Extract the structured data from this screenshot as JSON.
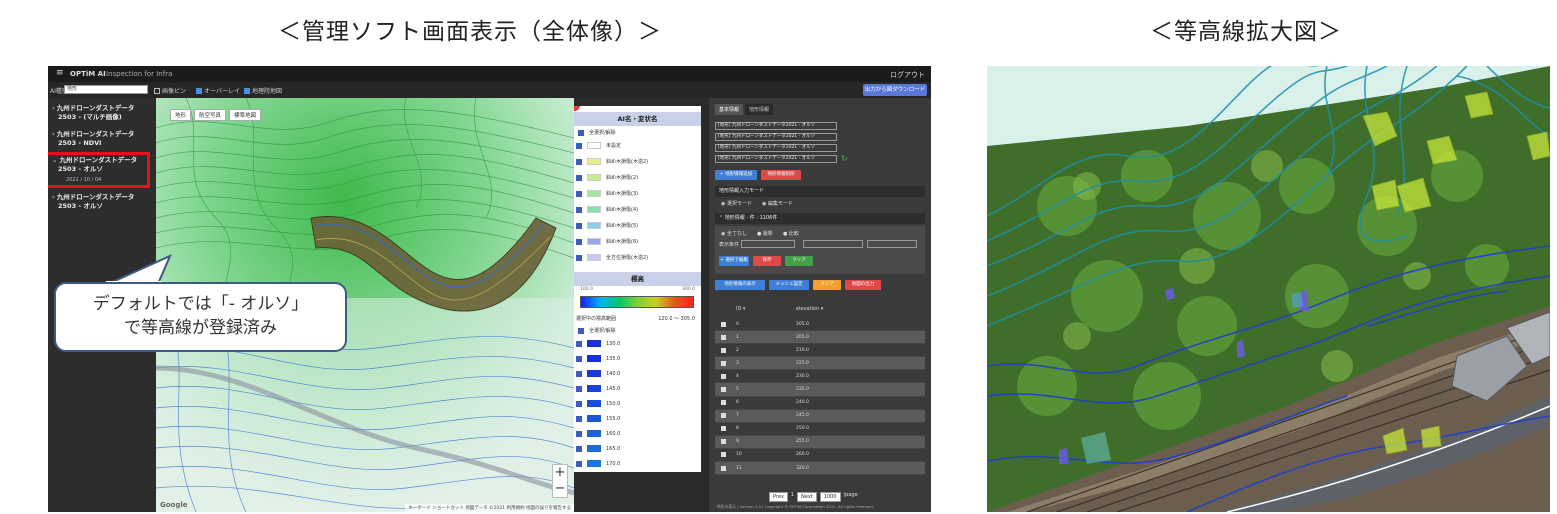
{
  "titles": {
    "left": "＜管理ソフト画面表示（全体像）＞",
    "right": "＜等高線拡大図＞"
  },
  "app": {
    "brand": "OPTiM AI",
    "brand_sub": "Inspection for Infra",
    "logout": "ログアウト",
    "ai_label": "AI種別",
    "ai_value": "地形",
    "toggles": [
      {
        "label": "画像ピン",
        "checked": false
      },
      {
        "label": "オーバーレイ",
        "checked": true
      },
      {
        "label": "地理院地図",
        "checked": true
      }
    ],
    "export_label": "出力から図ダウンロード",
    "sidebar": [
      {
        "line1": "九州ドローンダストデータ",
        "line2": "2503 - (マルチ画像)"
      },
      {
        "line1": "九州ドローンダストデータ",
        "line2": "2503 - NDVI"
      },
      {
        "line1": "九州ドローンダストデータ",
        "line2": "2503 - オルソ",
        "date": "2021 / 10 / 04",
        "expanded": true
      },
      {
        "line1": "九州ドローンダストデータ",
        "line2": "2503 - オルソ"
      }
    ],
    "map_tabs": [
      "地形",
      "航空写真",
      "標準地図"
    ],
    "map_zoom": [
      "+",
      "−"
    ],
    "google": "Google",
    "map_footer": "キーボード ショートカット  地図データ ©2021  利用規約  地図の誤りを報告する",
    "legend": {
      "header1": "AI名・変状名",
      "section1": "全選択/解除",
      "items": [
        {
          "label": "未設定",
          "color": "#ffffff"
        },
        {
          "label": "斜め木損傷(木造2)",
          "color": "#e6f08c"
        },
        {
          "label": "斜め木損傷(2)",
          "color": "#c8ee8c"
        },
        {
          "label": "斜め木損傷(3)",
          "color": "#a0e6a0"
        },
        {
          "label": "斜め木損傷(4)",
          "color": "#8cdcb4"
        },
        {
          "label": "斜め木損傷(5)",
          "color": "#8ccce6"
        },
        {
          "label": "斜め木損傷(6)",
          "color": "#9aa6ee"
        },
        {
          "label": "全方位損傷(木造2)",
          "color": "#c8c8f0"
        }
      ],
      "header2": "標高",
      "grad_min": "100.0",
      "grad_max": "300.0",
      "range_label": "選択中の標高範囲",
      "range_value": "120.0 ～ 305.0",
      "section2": "全選択/解除",
      "elev": [
        "130.0",
        "135.0",
        "140.0",
        "145.0",
        "150.0",
        "155.0",
        "160.0",
        "165.0",
        "170.0"
      ]
    },
    "right_panel": {
      "tabs": [
        "基本情報",
        "地形情報"
      ],
      "selects": [
        "[地形] 九州ドローンダストデータ2021 - オルソ",
        "[地形] 九州ドローンダストデータ2021 - オルソ",
        "[地形] 九州ドローンダストデータ2021 - オルソ",
        "[地形] 九州ドローンダストデータ2021 - オルソ"
      ],
      "btn_add": "+ 地形情報追加",
      "btn_delete": "地形情報削除",
      "section_mode": "地形情報入力モード",
      "mode_options": [
        "選択モード",
        "編集モード"
      ],
      "section_list": "地形情報 - 件 : 1106件",
      "filter_options": [
        "全てなし",
        "最新",
        "比較"
      ],
      "filter_label": "表示条件",
      "btn_edit": "+ 選択で編集",
      "btn_save": "保存",
      "btn_cancel": "クリア",
      "btn_csv": "地形情報の表示",
      "btn_mesh": "メッシュ設定",
      "btn_exec": "クリア",
      "btn_dl": "地図の出力",
      "col1": "ID",
      "col2": "elevation",
      "rows": [
        {
          "id": "0",
          "elev": "205.0"
        },
        {
          "id": "1",
          "elev": "205.0"
        },
        {
          "id": "2",
          "elev": "210.0"
        },
        {
          "id": "3",
          "elev": "225.0"
        },
        {
          "id": "4",
          "elev": "230.0"
        },
        {
          "id": "5",
          "elev": "235.0"
        },
        {
          "id": "6",
          "elev": "240.0"
        },
        {
          "id": "7",
          "elev": "245.0"
        },
        {
          "id": "8",
          "elev": "250.0"
        },
        {
          "id": "9",
          "elev": "255.0"
        },
        {
          "id": "10",
          "elev": "260.0"
        },
        {
          "id": "11",
          "elev": "320.0"
        }
      ],
      "pager": [
        "Prev",
        "1",
        "Next",
        "1000",
        "/page"
      ],
      "footer": "地形の表示 | Version 1.0 | Copyright © OPTiM Corporation 2021, All rights reserved."
    },
    "callout": {
      "line1": "デフォルトでは「- オルソ」",
      "line2": "で等高線が登録済み"
    },
    "colors": {
      "highlight": "#e0151c",
      "callout_border": "#3d5a85",
      "accent": "#5b78d8"
    }
  }
}
